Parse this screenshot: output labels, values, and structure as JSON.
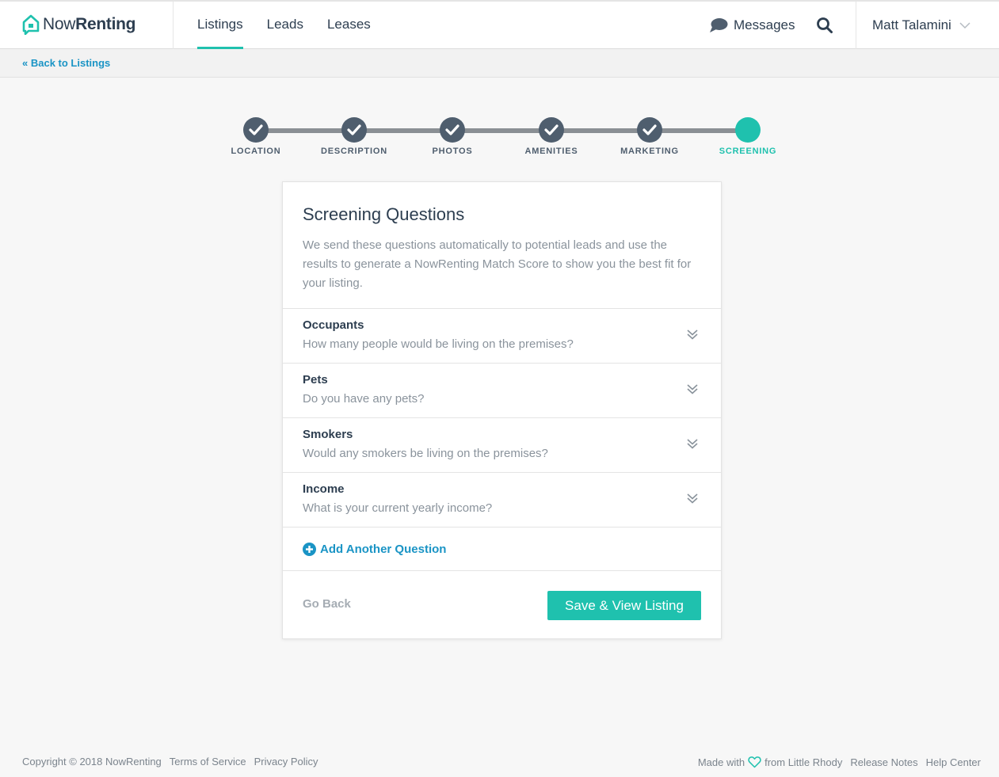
{
  "header": {
    "brand_regular": "Now",
    "brand_bold": "Renting",
    "nav": [
      "Listings",
      "Leads",
      "Leases"
    ],
    "active_nav": "Listings",
    "messages_label": "Messages",
    "user_name": "Matt Talamini"
  },
  "subbar": {
    "back_label": "« Back to Listings"
  },
  "steps": [
    {
      "label": "LOCATION",
      "state": "complete"
    },
    {
      "label": "DESCRIPTION",
      "state": "complete"
    },
    {
      "label": "PHOTOS",
      "state": "complete"
    },
    {
      "label": "AMENITIES",
      "state": "complete"
    },
    {
      "label": "MARKETING",
      "state": "complete"
    },
    {
      "label": "SCREENING",
      "state": "current"
    }
  ],
  "card": {
    "title": "Screening Questions",
    "description": "We send these questions automatically to potential leads and use the results to generate a NowRenting Match Score to show you the best fit for your listing.",
    "questions": [
      {
        "title": "Occupants",
        "text": "How many people would be living on the premises?"
      },
      {
        "title": "Pets",
        "text": "Do you have any pets?"
      },
      {
        "title": "Smokers",
        "text": "Would any smokers be living on the premises?"
      },
      {
        "title": "Income",
        "text": "What is your current yearly income?"
      }
    ],
    "add_label": "Add Another Question",
    "go_back_label": "Go Back",
    "save_label": "Save & View Listing"
  },
  "footer": {
    "copyright": "Copyright © 2018 NowRenting",
    "terms": "Terms of Service",
    "privacy": "Privacy Policy",
    "made_with": "Made with",
    "from": "from Little Rhody",
    "release_notes": "Release Notes",
    "help_center": "Help Center"
  },
  "colors": {
    "accent": "#1fc1ae",
    "link": "#1a94c5",
    "step_complete": "#4f5e6e",
    "text_dark": "#2d3e50",
    "text_muted": "#8a939c"
  },
  "icons": [
    "logo-icon",
    "chat-bubble-icon",
    "search-icon",
    "chevron-down-icon",
    "check-icon",
    "double-chevron-down-icon",
    "plus-circle-icon",
    "heart-icon"
  ]
}
